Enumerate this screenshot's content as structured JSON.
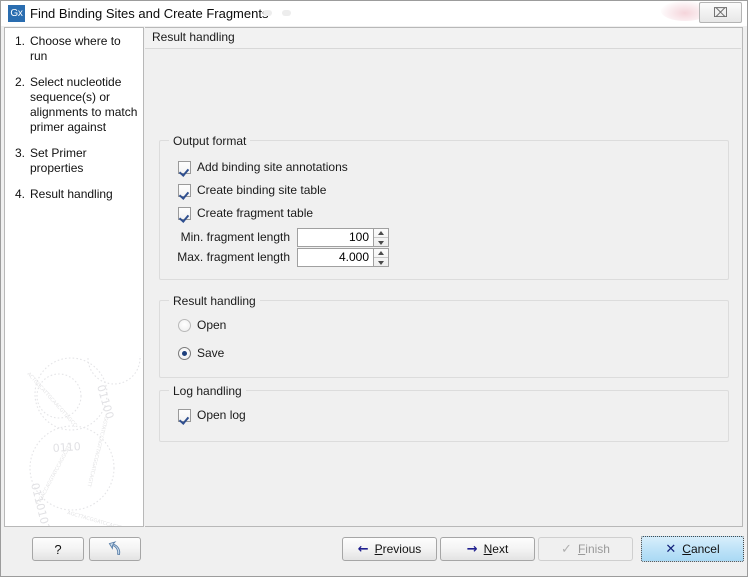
{
  "window": {
    "app_icon_label": "Gx",
    "title": "Find Binding Sites and Create Fragments",
    "close_glyph": "⌧"
  },
  "sidebar": {
    "steps": [
      {
        "num": "1.",
        "label": "Choose where to run"
      },
      {
        "num": "2.",
        "label": "Select nucleotide sequence(s) or alignments to match primer against"
      },
      {
        "num": "3.",
        "label": "Set Primer properties"
      },
      {
        "num": "4.",
        "label": "Result handling"
      }
    ]
  },
  "main": {
    "header": "Result handling",
    "output_format": {
      "title": "Output format",
      "checkboxes": [
        {
          "label": "Add binding site annotations",
          "checked": true
        },
        {
          "label": "Create binding site table",
          "checked": true
        },
        {
          "label": "Create fragment table",
          "checked": true
        }
      ],
      "spinners": [
        {
          "label": "Min. fragment length",
          "value": "100"
        },
        {
          "label": "Max. fragment length",
          "value": "4.000"
        }
      ]
    },
    "result_handling": {
      "title": "Result handling",
      "options": [
        {
          "label": "Open",
          "selected": false
        },
        {
          "label": "Save",
          "selected": true
        }
      ]
    },
    "log_handling": {
      "title": "Log handling",
      "checkboxes": [
        {
          "label": "Open log",
          "checked": true
        }
      ]
    }
  },
  "buttons": {
    "help": "?",
    "reset_icon": "reset-arrow-icon",
    "previous": {
      "pre": "",
      "mnemonic": "P",
      "post": "revious",
      "glyph": "←"
    },
    "next": {
      "pre": "",
      "mnemonic": "N",
      "post": "ext",
      "glyph": "→"
    },
    "finish": {
      "pre": "",
      "mnemonic": "F",
      "post": "inish",
      "glyph": "✓",
      "disabled": true
    },
    "cancel": {
      "pre": "",
      "mnemonic": "C",
      "post": "ancel",
      "glyph": "✕"
    }
  },
  "colors": {
    "accent_blue": "#2a6db0",
    "check_blue": "#2f4f8f",
    "radio_blue": "#1d3f7c",
    "cancel_highlight": "#bfe3f8",
    "window_bg": "#f0f0f0"
  }
}
